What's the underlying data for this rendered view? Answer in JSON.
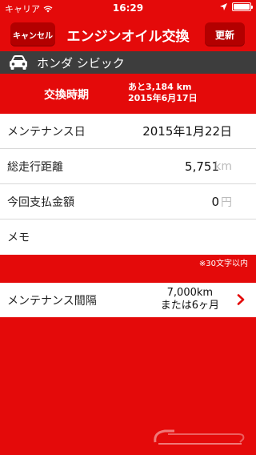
{
  "status_bar": {
    "carrier": "キャリア",
    "time": "16:29"
  },
  "nav": {
    "cancel_label": "キャンセル",
    "title": "エンジンオイル交換",
    "update_label": "更新"
  },
  "car": {
    "name": "ホンダ シビック",
    "icon": "car-icon"
  },
  "interval_info": {
    "label": "交換時期",
    "remaining": "あと3,184 km",
    "date": "2015年6月17日"
  },
  "form": {
    "maintenance_date_label": "メンテナンス日",
    "maintenance_date_value": "2015年1月22日",
    "mileage_label": "総走行距離",
    "mileage_value": "5,751",
    "mileage_unit": "km",
    "payment_label": "今回支払金額",
    "payment_value": "0",
    "payment_unit": "円",
    "memo_label": "メモ"
  },
  "memo_note": "※30文字以内",
  "maintenance_interval": {
    "label": "メンテナンス間隔",
    "distance": "7,000km",
    "period": "または6ヶ月"
  },
  "colors": {
    "brand_red": "#e40a0a",
    "button_red": "#b30000",
    "car_header_bg": "#3d3d3d"
  }
}
